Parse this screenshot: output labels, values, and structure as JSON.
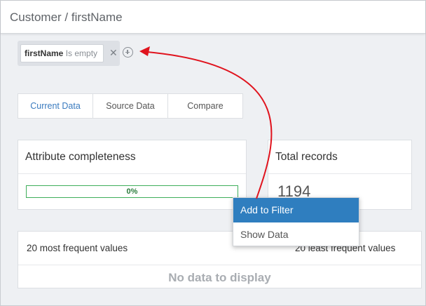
{
  "header": {
    "breadcrumb": "Customer / firstName"
  },
  "filter": {
    "field": "firstName",
    "operator": "Is empty",
    "remove_icon": "close-icon",
    "add_icon": "plus-circle-icon"
  },
  "tabs": [
    {
      "label": "Current Data",
      "active": true
    },
    {
      "label": "Source Data",
      "active": false
    },
    {
      "label": "Compare",
      "active": false
    }
  ],
  "completeness": {
    "title": "Attribute completeness",
    "value_label": "0%"
  },
  "records": {
    "title": "Total records",
    "count": "1194"
  },
  "frequency": {
    "most_title": "20 most frequent values",
    "least_title": "20 least frequent values",
    "empty_message": "No data to display"
  },
  "context_menu": {
    "items": [
      {
        "label": "Add to Filter",
        "highlighted": true
      },
      {
        "label": "Show Data",
        "highlighted": false
      }
    ]
  },
  "colors": {
    "accent": "#2f7ebf",
    "progress_border": "#3fae5b",
    "annotation_arrow": "#e0141e"
  }
}
